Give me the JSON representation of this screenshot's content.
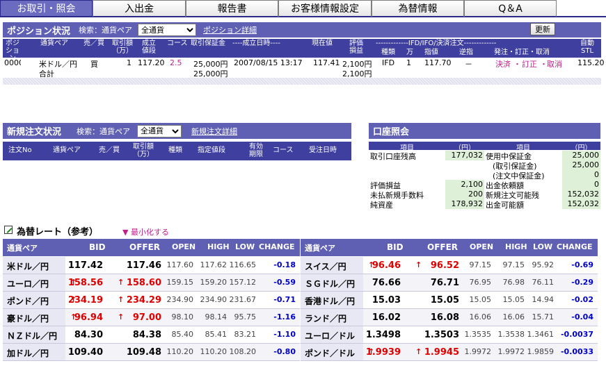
{
  "tabs": [
    "お取引・照会",
    "入出金",
    "報告書",
    "お客様情報設定",
    "為替情報",
    "Q＆A"
  ],
  "position": {
    "title": "ポジション状況",
    "search_label": "検索：通貨ペア",
    "filter_value": "全通貨",
    "detail_link": "ポジション詳細",
    "refresh_button": "更新",
    "headers": [
      "ポジション\nNo",
      "通貨ペア",
      "売／買",
      "取引額\n（万）",
      "成立\n値段",
      "コース",
      "取引保証金",
      "----成立日時----",
      "現在値",
      "評価\n損益",
      "-------------IFD/IFO/決済注文-------------",
      "自動\nSTL"
    ],
    "sub_headers": [
      "種類",
      "万",
      "指値",
      "逆指",
      "発注・訂正・取消"
    ],
    "rows": [
      {
        "no": "0000",
        "pair": "米ドル／円",
        "side": "買",
        "amount": "1",
        "price": "117.20",
        "course": "2.5",
        "margin": "25,000円",
        "datetime": "2007/08/15 13:17",
        "current": "117.41",
        "pl": "2,100円",
        "type": "IFD",
        "man": "1",
        "limit": "117.70",
        "stop": "－",
        "order_a": "決済",
        "order_b": "訂正",
        "order_c": "取消",
        "stl": "115.20"
      }
    ],
    "total_label": "合計",
    "total_margin": "25,000円",
    "total_pl": "2,100円"
  },
  "new_orders": {
    "title": "新規注文状況",
    "search_label": "検索：通貨ペア",
    "filter_value": "全通貨",
    "detail_link": "新規注文詳細",
    "headers": [
      "注文No",
      "通貨ペア",
      "売／買",
      "取引額\n（万）",
      "種類",
      "指定値段",
      "有効\n期限",
      "コース",
      "受注日時"
    ]
  },
  "account": {
    "title": "口座照会",
    "headers": [
      "項目",
      "（円）",
      "項目",
      "（円）"
    ],
    "left": [
      {
        "label": "取引口座残高",
        "value": "177,032"
      },
      {
        "label": "",
        "value": ""
      },
      {
        "label": "",
        "value": ""
      },
      {
        "label": "評価損益",
        "value": "2,100"
      },
      {
        "label": "未払新規手数料",
        "value": "200"
      },
      {
        "label": "純資産",
        "value": "178,932"
      }
    ],
    "right": [
      {
        "label": "使用中保証金",
        "value": "25,000"
      },
      {
        "label": "(取引保証金)",
        "value": "25,000"
      },
      {
        "label": "(注文中保証金)",
        "value": "0"
      },
      {
        "label": "出金依頼額",
        "value": "0"
      },
      {
        "label": "新規注文可能残",
        "value": "152,032"
      },
      {
        "label": "出金可能額",
        "value": "152,032"
      }
    ]
  },
  "rates": {
    "title": "為替レート（参考）",
    "minimize": "最小化する",
    "headers": [
      "通貨ペア",
      "BID",
      "OFFER",
      "OPEN",
      "HIGH",
      "LOW",
      "CHANGE"
    ],
    "left": [
      {
        "pair": "米ドル／円",
        "bid": "117.42",
        "offer": "117.46",
        "open": "117.60",
        "high": "117.62",
        "low": "116.65",
        "change": "-0.18",
        "up": false
      },
      {
        "pair": "ユーロ／円",
        "bid": "158.56",
        "offer": "158.60",
        "open": "159.15",
        "high": "159.20",
        "low": "157.12",
        "change": "-0.59",
        "up": true
      },
      {
        "pair": "ポンド／円",
        "bid": "234.19",
        "offer": "234.29",
        "open": "234.90",
        "high": "234.90",
        "low": "231.67",
        "change": "-0.71",
        "up": true
      },
      {
        "pair": "豪ドル／円",
        "bid": "96.94",
        "offer": "97.00",
        "open": "98.10",
        "high": "98.14",
        "low": "95.75",
        "change": "-1.16",
        "up": true
      },
      {
        "pair": "ＮＺドル／円",
        "bid": "84.30",
        "offer": "84.38",
        "open": "85.40",
        "high": "85.41",
        "low": "83.21",
        "change": "-1.10",
        "up": false
      },
      {
        "pair": "加ドル／円",
        "bid": "109.40",
        "offer": "109.48",
        "open": "110.20",
        "high": "110.20",
        "low": "108.20",
        "change": "-0.80",
        "up": false
      }
    ],
    "right": [
      {
        "pair": "スイス／円",
        "bid": "96.46",
        "offer": "96.52",
        "open": "97.15",
        "high": "97.15",
        "low": "95.92",
        "change": "-0.69",
        "up": true
      },
      {
        "pair": "ＳＧドル／円",
        "bid": "76.66",
        "offer": "76.71",
        "open": "76.95",
        "high": "76.98",
        "low": "76.11",
        "change": "-0.29",
        "up": false
      },
      {
        "pair": "香港ドル／円",
        "bid": "15.03",
        "offer": "15.05",
        "open": "15.05",
        "high": "15.05",
        "low": "14.94",
        "change": "-0.02",
        "up": false
      },
      {
        "pair": "ランド／円",
        "bid": "16.02",
        "offer": "16.08",
        "open": "16.06",
        "high": "16.06",
        "low": "15.71",
        "change": "-0.04",
        "up": false
      },
      {
        "pair": "ユーロ／ドル",
        "bid": "1.3498",
        "offer": "1.3503",
        "open": "1.3535",
        "high": "1.3538",
        "low": "1.3461",
        "change": "-0.0037",
        "up": false
      },
      {
        "pair": "ポンド／ドル",
        "bid": "1.9939",
        "offer": "1.9945",
        "open": "1.9972",
        "high": "1.9972",
        "low": "1.9859",
        "change": "-0.0033",
        "up": true
      }
    ]
  },
  "colors": {
    "accent": "#5f5fb4",
    "header_dark": "#3f3fa0",
    "up": "#e00000",
    "change": "#0000cc",
    "green_cell": "#dff0d8",
    "magenta": "#c0208a"
  }
}
